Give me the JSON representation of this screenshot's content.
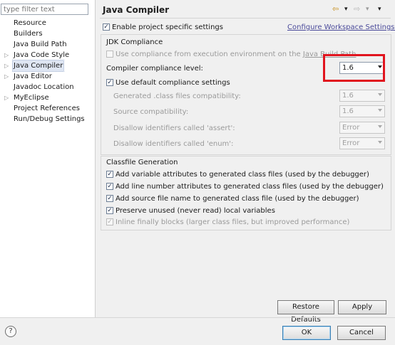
{
  "filter": {
    "placeholder": "type filter text"
  },
  "tree": [
    {
      "label": "Resource",
      "expandable": false
    },
    {
      "label": "Builders",
      "expandable": false
    },
    {
      "label": "Java Build Path",
      "expandable": false
    },
    {
      "label": "Java Code Style",
      "expandable": true
    },
    {
      "label": "Java Compiler",
      "expandable": true,
      "selected": true
    },
    {
      "label": "Java Editor",
      "expandable": true
    },
    {
      "label": "Javadoc Location",
      "expandable": false
    },
    {
      "label": "MyEclipse",
      "expandable": true
    },
    {
      "label": "Project References",
      "expandable": false
    },
    {
      "label": "Run/Debug Settings",
      "expandable": false
    }
  ],
  "page": {
    "title": "Java Compiler",
    "nav": {
      "back": "⇦",
      "down1": "▾",
      "forward": "⇨",
      "down2": "▾",
      "menu": "▾"
    },
    "enable_project_settings": {
      "label": "Enable project specific settings",
      "checked": true
    },
    "configure_link": "Configure Workspace Settings...",
    "jdk_group": {
      "title": "JDK Compliance",
      "use_env": {
        "label_pre": "Use compliance from execution environment on the ",
        "link": "Java Build Path",
        "checked": false
      },
      "compliance_label": "Compiler compliance level:",
      "compliance_value": "1.6",
      "use_default": {
        "label": "Use default compliance settings",
        "checked": true
      },
      "rows": [
        {
          "label": "Generated .class files compatibility:",
          "value": "1.6"
        },
        {
          "label": "Source compatibility:",
          "value": "1.6"
        },
        {
          "label": "Disallow identifiers called 'assert':",
          "value": "Error"
        },
        {
          "label": "Disallow identifiers called 'enum':",
          "value": "Error"
        }
      ]
    },
    "classfile_group": {
      "title": "Classfile Generation",
      "options": [
        {
          "label": "Add variable attributes to generated class files (used by the debugger)",
          "checked": true,
          "enabled": true
        },
        {
          "label": "Add line number attributes to generated class files (used by the debugger)",
          "checked": true,
          "enabled": true
        },
        {
          "label": "Add source file name to generated class file (used by the debugger)",
          "checked": true,
          "enabled": true
        },
        {
          "label": "Preserve unused (never read) local variables",
          "checked": true,
          "enabled": true
        },
        {
          "label": "Inline finally blocks (larger class files, but improved performance)",
          "checked": true,
          "enabled": false
        }
      ]
    },
    "restore_defaults": "Restore Defaults",
    "apply": "Apply"
  },
  "footer": {
    "help": "?",
    "ok": "OK",
    "cancel": "Cancel"
  },
  "colors": {
    "highlight": "#e1141e",
    "selection": "#dfe6f3",
    "link": "#4a4a9a"
  }
}
